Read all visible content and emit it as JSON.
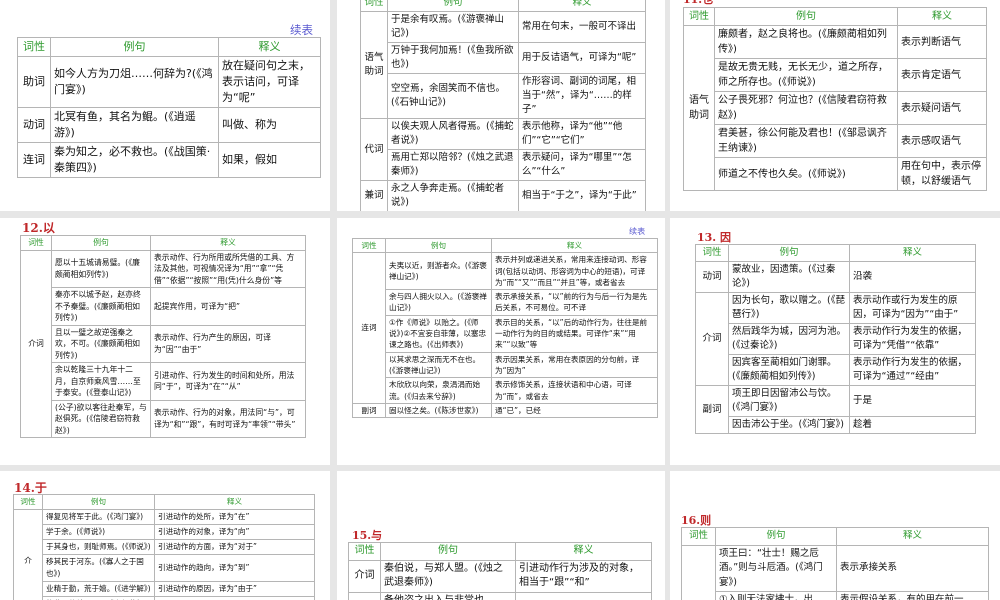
{
  "colors": {
    "title": "#c0282a",
    "header": "#2e9a2e",
    "note": "#5a5ad0"
  },
  "panels": [
    {
      "title": "",
      "note": "续表",
      "headers": [
        "词性",
        "例句",
        "释义"
      ],
      "rows": [
        {
          "pos": "助词",
          "span": 1,
          "ex": "如今人方为刀俎……何辞为?(《鸿门宴》)",
          "def": "放在疑问句之末，表示诘问，可译为“呢”"
        },
        {
          "pos": "动词",
          "span": 1,
          "ex": "北冥有鱼，其名为鲲。(《逍遥游》)",
          "def": "叫做、称为"
        },
        {
          "pos": "连词",
          "span": 1,
          "ex": "秦为知之，必不救也。(《战国策·秦策四》)",
          "def": "如果，假如"
        }
      ]
    },
    {
      "title": "",
      "note": "",
      "headers": [
        "词性",
        "例句",
        "释义"
      ],
      "rows": [
        {
          "pos": "语气助词",
          "span": 3,
          "ex": "于是余有叹焉。(《游褒禅山记》)",
          "def": "常用在句末，一般可不译出"
        },
        {
          "ex": "万钟于我何加焉！(《鱼我所欲也》)",
          "def": "用于反诘语气，可译为“呢”"
        },
        {
          "ex": "空空焉，余固笑而不信也。(《石钟山记》)",
          "def": "作形容词、副词的词尾，相当于“然”，译为“……的样子”"
        },
        {
          "pos": "代词",
          "span": 2,
          "ex": "以俟夫观人风者得焉。(《捕蛇者说》)",
          "def": "表示他称，译为“他”“他们”“它”“它们”"
        },
        {
          "ex": "焉用亡郑以陪邻？(《烛之武退秦师》)",
          "def": "表示疑问，译为“哪里”“怎么”“什么”"
        },
        {
          "pos": "兼词",
          "span": 1,
          "ex": "永之人争奔走焉。(《捕蛇者说》)",
          "def": "相当于“于之”，译为“于此”"
        }
      ]
    },
    {
      "title": "11.也",
      "note": "",
      "headers": [
        "词性",
        "例句",
        "释义"
      ],
      "rows": [
        {
          "pos": "语气助词",
          "span": 5,
          "ex": "廉颇者，赵之良将也。(《廉颇蔺相如列传》)",
          "def": "表示判断语气"
        },
        {
          "ex": "是故无贵无贱，无长无少，道之所存，师之所存也。(《师说》)",
          "def": "表示肯定语气"
        },
        {
          "ex": "公子畏死邪？何泣也？(《信陵君窃符救赵》)",
          "def": "表示疑问语气"
        },
        {
          "ex": "君美甚，徐公何能及君也！(《邹忌讽齐王纳谏》)",
          "def": "表示感叹语气"
        },
        {
          "ex": "师道之不传也久矣。(《师说》)",
          "def": "用在句中，表示停顿，以舒缓语气"
        }
      ]
    },
    {
      "title": "12.以",
      "note": "",
      "headers": [
        "词性",
        "例句",
        "释义"
      ],
      "rows": [
        {
          "pos": "介词",
          "span": 5,
          "ex": "愿以十五城请易璧。(《廉颇蔺相如列传》)",
          "def": "表示动作、行为所用或所凭借的工具、方法及其他，可视情况译为“用”“拿”“凭借”“依据”“按照”“用(凭)什么身份”等"
        },
        {
          "ex": "秦亦不以城予赵，赵亦终不予秦璧。(《廉颇蔺相如列传》)",
          "def": "起提宾作用，可译为“把”"
        },
        {
          "ex": "且以一璧之故逆强秦之欢，不可。(《廉颇蔺相如列传》)",
          "def": "表示动作、行为产生的原因，可译为“因”“由于”"
        },
        {
          "ex": "余以乾隆三十九年十二月，自京师乘风雪……至于泰安。(《登泰山记》)",
          "def": "引进动作、行为发生的时间和处所，用法同“于”，可译为“在”“从”"
        },
        {
          "ex": "(公子)欲以客往赴秦军，与赵俱死。(《信陵君窃符救赵》)",
          "def": "表示动作、行为的对象，用法同“与”，可译为“和”“跟”，有时可译为“率领”“带头”"
        }
      ]
    },
    {
      "title": "",
      "note": "续表",
      "headers": [
        "词性",
        "例句",
        "释义"
      ],
      "rows": [
        {
          "pos": "连词",
          "span": 5,
          "ex": "夫夷以近，则游者众。(《游褒禅山记》)",
          "def": "表示并列或递进关系，常用来连接动词、形容词(包括以动词、形容词为中心的短语)，可译为“而”“又”“而且”“并且”等，或者省去"
        },
        {
          "ex": "余与四人拥火以入。(《游褒禅山记》)",
          "def": "表示承接关系，“以”前的行为与后一行为是先后关系，不可易位。可不译"
        },
        {
          "ex": "①作《师说》以贻之。(《师说》)②不宜妄自菲薄，以塞忠谏之路也。(《出师表》)",
          "def": "表示目的关系，“以”后的动作行为，往往是前一动作行为的目的或结果。可译作“来”“用来”“以致”等"
        },
        {
          "ex": "以其求思之深而无不在也。(《游褒禅山记》)",
          "def": "表示因果关系，常用在表原因的分句前，译为“因为”"
        },
        {
          "ex": "木欣欣以向荣，泉涓涓而始流。(《归去来兮辞》)",
          "def": "表示修饰关系，连接状语和中心语，可译为“而”，或省去"
        },
        {
          "pos": "副词",
          "span": 1,
          "ex": "固以怪之矣。(《陈涉世家》)",
          "def": "通“已”，已经"
        }
      ]
    },
    {
      "title": "13. 因",
      "note": "",
      "headers": [
        "词性",
        "例句",
        "释义"
      ],
      "rows": [
        {
          "pos": "动词",
          "span": 1,
          "ex": "蒙故业，因遗策。(《过秦论》)",
          "def": "沿袭"
        },
        {
          "pos": "介词",
          "span": 3,
          "ex": "因为长句，歌以赠之。(《琵琶行》)",
          "def": "表示动作或行为发生的原因，可译为“因为”“由于”"
        },
        {
          "ex": "然后践华为城，因河为池。(《过秦论》)",
          "def": "表示动作行为发生的依据，可译为“凭借”“依靠”"
        },
        {
          "ex": "因宾客至蔺相如门谢罪。(《廉颇蔺相如列传》)",
          "def": "表示动作行为发生的依据，可译为“通过”“经由”"
        },
        {
          "pos": "副词",
          "span": 2,
          "ex": "项王即日因留沛公与饮。(《鸿门宴》)",
          "def": "于是"
        },
        {
          "ex": "因击沛公于坐。(《鸿门宴》)",
          "def": "趁着"
        }
      ]
    },
    {
      "title": "14.于",
      "note": "",
      "headers": [
        "词性",
        "例句",
        "释义"
      ],
      "rows": [
        {
          "pos": "介",
          "span": 6,
          "ex": "得复见将军于此。(《鸿门宴》)",
          "def": "引进动作的处所，译为“在”"
        },
        {
          "ex": "学于余。(《师说》)",
          "def": "引进动作的对象，译为“向”"
        },
        {
          "ex": "于其身也，则耻师焉。(《师说》)",
          "def": "引进动作的方面，译为“对于”"
        },
        {
          "ex": "移其民于河东。(《寡人之于国也》)",
          "def": "引进动作的趋向，译为“到”"
        },
        {
          "ex": "业精于勤，荒于嬉。(《进学解》)",
          "def": "引进动作的原因，译为“由于”"
        },
        {
          "ex": "故燕王欲结于君。(《廉颇蔺相",
          "def": ""
        }
      ]
    },
    {
      "title": "15.与",
      "note": "",
      "headers": [
        "词性",
        "例句",
        "释义"
      ],
      "rows": [
        {
          "pos": "介词",
          "span": 1,
          "ex": "秦伯说，与郑人盟。(《烛之武退秦师》)",
          "def": "引进动作行为涉及的对象，相当于“跟”“和”"
        },
        {
          "pos": "",
          "span": 1,
          "ex": "备他盗之出入与非常也。",
          "def": ""
        }
      ]
    },
    {
      "title": "16.则",
      "note": "",
      "headers": [
        "词性",
        "例句",
        "释义"
      ],
      "rows": [
        {
          "pos": "",
          "span": 2,
          "ex": "项王曰：“壮士！赐之卮酒。”则与斗卮酒。(《鸿门宴》)",
          "def": "表示承接关系"
        },
        {
          "ex": "①入则无法家拂士，出",
          "def": "表示假设关系，有的用在前一"
        }
      ]
    }
  ]
}
